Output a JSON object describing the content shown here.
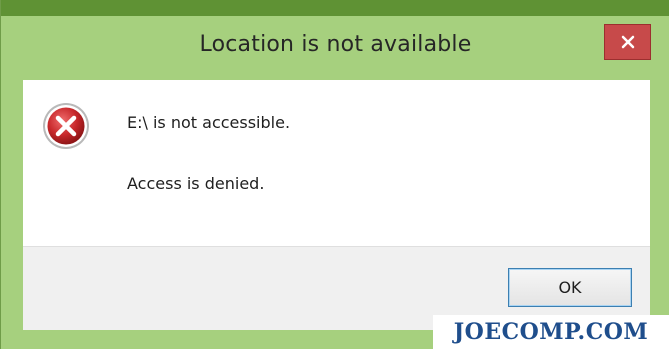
{
  "dialog": {
    "title": "Location is not available",
    "close_icon": "close-icon",
    "status_icon": "error-icon",
    "messages": [
      "E:\\ is not accessible.",
      "Access is denied."
    ],
    "ok_label": "OK"
  },
  "watermark": {
    "text": "JOECOMP.COM"
  },
  "colors": {
    "titlebar": "#a6d07e",
    "close_button": "#c74a4a",
    "error_icon": "#c8282b",
    "ok_button_border": "#3c7fb1"
  }
}
